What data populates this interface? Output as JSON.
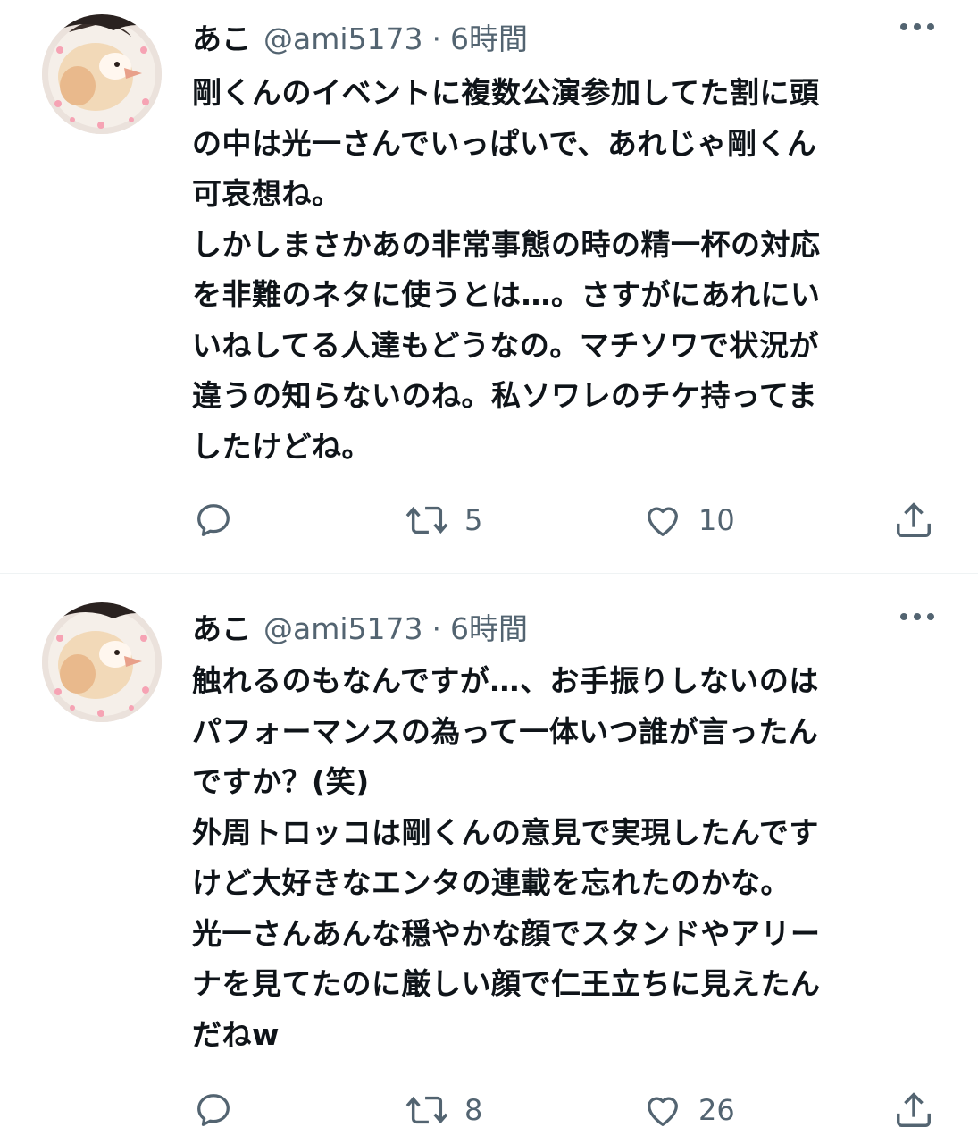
{
  "tweets": [
    {
      "author_name": "あこ",
      "handle": "@ami5173",
      "separator": "·",
      "time": "6時間",
      "text": "剛くんのイベントに複数公演参加してた割に頭\nの中は光一さんでいっぱいで、あれじゃ剛くん\n可哀想ね。\nしかしまさかあの非常事態の時の精一杯の対応\nを非難のネタに使うとは…。さすがにあれにい\nいねしてる人達もどうなの。マチソワで状況が\n違うの知らないのね。私ソワレのチケ持ってま\nしたけどね。",
      "retweets": "5",
      "likes": "10",
      "icons": [
        "reply-icon",
        "retweet-icon",
        "heart-icon",
        "share-icon",
        "more-icon"
      ]
    },
    {
      "author_name": "あこ",
      "handle": "@ami5173",
      "separator": "·",
      "time": "6時間",
      "text": "触れるのもなんですが…、お手振りしないのは\nパフォーマンスの為って一体いつ誰が言ったん\nですか？(笑)\n外周トロッコは剛くんの意見で実現したんです\nけど大好きなエンタの連載を忘れたのかな。\n光一さんあんな穏やかな顔でスタンドやアリー\nナを見てたのに厳しい顔で仁王立ちに見えたん\nだねw",
      "retweets": "8",
      "likes": "26",
      "icons": [
        "reply-icon",
        "retweet-icon",
        "heart-icon",
        "share-icon",
        "more-icon"
      ]
    }
  ],
  "colors": {
    "text": "#0f1419",
    "secondary": "#536471",
    "divider": "#eff3f4"
  }
}
